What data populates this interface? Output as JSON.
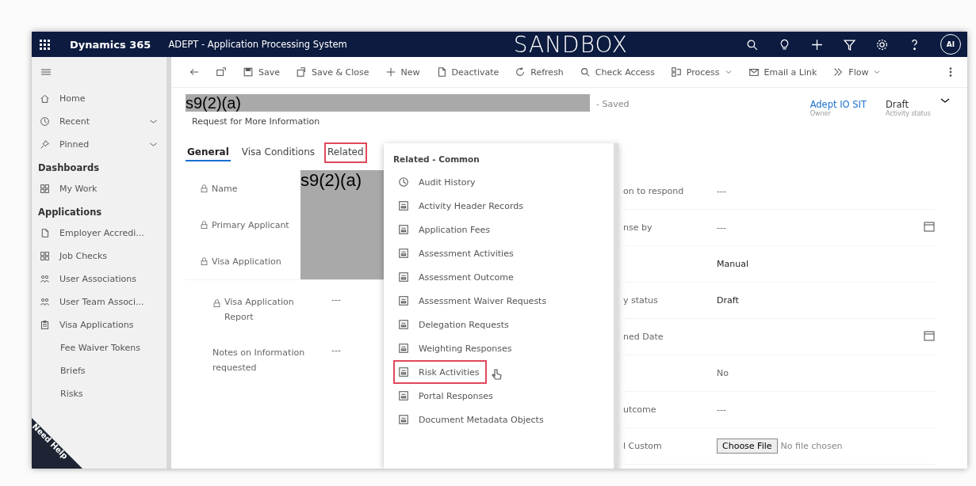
{
  "top_bar": {
    "app_name": "Dynamics 365",
    "system_name": "ADEPT - Application Processing System",
    "environment": "SANDBOX",
    "avatar": "AI"
  },
  "command_bar": [
    {
      "dropdown": false
    },
    {
      "dropdown": false
    },
    {
      "label": "Save",
      "dropdown": false
    },
    {
      "label": "Save & Close",
      "dropdown": false
    },
    {
      "label": "New",
      "dropdown": false
    },
    {
      "label": "Deactivate",
      "dropdown": false
    },
    {
      "label": "Refresh",
      "dropdown": false
    },
    {
      "label": "Check Access",
      "dropdown": false
    },
    {
      "label": "Process",
      "dropdown": true
    },
    {
      "label": "Email a Link",
      "dropdown": false
    },
    {
      "label": "Flow",
      "dropdown": true
    },
    {
      "dropdown": false
    }
  ],
  "sidebar": {
    "groups": [
      {
        "items": [
          {
            "label": "Home",
            "expandable": false
          },
          {
            "label": "Recent",
            "expandable": true
          },
          {
            "label": "Pinned",
            "expandable": true
          }
        ]
      },
      {
        "heading": "Dashboards",
        "items": [
          {
            "label": "My Work",
            "expandable": false
          }
        ]
      },
      {
        "heading": "Applications",
        "items": [
          {
            "label": "Employer Accredi...",
            "expandable": false
          },
          {
            "label": "Job Checks",
            "expandable": false
          },
          {
            "label": "User Associations",
            "expandable": false
          },
          {
            "label": "User Team Associ...",
            "expandable": false
          },
          {
            "label": "Visa Applications",
            "expandable": false
          },
          {
            "label": "Fee Waiver Tokens",
            "expandable": false
          },
          {
            "label": "Briefs",
            "expandable": false
          },
          {
            "label": "Risks",
            "expandable": false
          }
        ]
      }
    ]
  },
  "need_help": "Need Help",
  "record": {
    "title_redaction": "s9(2)(a)",
    "save_status": "- Saved",
    "entity": "Request for More Information",
    "header_fields": [
      {
        "kind": "link",
        "value": "Adept IO SIT",
        "label": "Owner"
      },
      {
        "kind": "text",
        "value": "Draft",
        "label": "Activity status"
      }
    ]
  },
  "tabs": [
    {
      "label": "General",
      "selected": true,
      "highlighted": false
    },
    {
      "label": "Visa Conditions",
      "selected": false,
      "highlighted": false
    },
    {
      "label": "Related",
      "selected": false,
      "highlighted": true
    }
  ],
  "fields": [
    {
      "label": "Name",
      "locked": true
    },
    {
      "label": "Primary Applicant",
      "locked": true
    },
    {
      "label": "Visa Application",
      "locked": true
    }
  ],
  "field_redaction": "s9(2)(a)",
  "subsection_fields": [
    {
      "label": "Visa Application Report",
      "locked": true,
      "value": "---"
    },
    {
      "label": "Notes on Information requested",
      "locked": false,
      "value": "---"
    }
  ],
  "related_menu": {
    "heading": "Related - Common",
    "items": [
      {
        "kind": "history",
        "label": "Audit History",
        "highlighted": false
      },
      {
        "kind": "entity",
        "label": "Activity Header Records",
        "highlighted": false
      },
      {
        "kind": "entity",
        "label": "Application Fees",
        "highlighted": false
      },
      {
        "kind": "entity",
        "label": "Assessment Activities",
        "highlighted": false
      },
      {
        "kind": "entity",
        "label": "Assessment Outcome",
        "highlighted": false
      },
      {
        "kind": "entity",
        "label": "Assessment Waiver Requests",
        "highlighted": false
      },
      {
        "kind": "entity",
        "label": "Delegation Requests",
        "highlighted": false
      },
      {
        "kind": "entity",
        "label": "Weighting Responses",
        "highlighted": false
      },
      {
        "kind": "entity",
        "label": "Risk Activities",
        "highlighted": true
      },
      {
        "kind": "entity",
        "label": "Portal Responses",
        "highlighted": false
      },
      {
        "kind": "entity",
        "label": "Document Metadata Objects",
        "highlighted": false
      }
    ]
  },
  "right_fields": [
    {
      "kind": "text",
      "label": "on to respond",
      "value": "---"
    },
    {
      "kind": "date",
      "label": "nse by",
      "value": "---"
    },
    {
      "kind": "text",
      "value": "Manual"
    },
    {
      "kind": "text",
      "label": "y status",
      "value": "Draft"
    },
    {
      "kind": "date",
      "label": "ned Date"
    },
    {
      "kind": "text",
      "value": "No"
    },
    {
      "kind": "text",
      "label": "utcome",
      "value": "---"
    },
    {
      "kind": "file",
      "label": "l Custom",
      "button": "Choose File",
      "value": "No file chosen"
    }
  ]
}
